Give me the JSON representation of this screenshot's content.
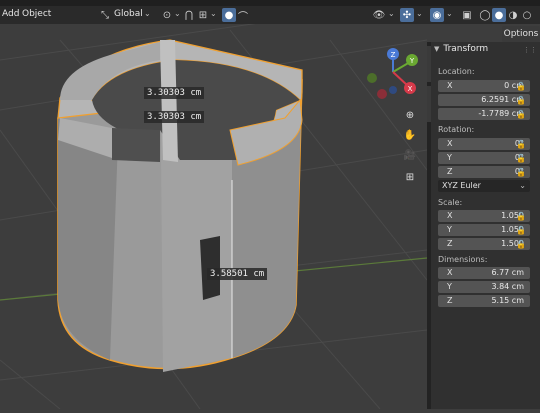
{
  "header": {
    "menus": [
      "Add",
      "Object"
    ],
    "orientation": "Global",
    "chevron": "⌄"
  },
  "viewport": {
    "measurements": [
      "3.30303 cm",
      "3.30303 cm",
      "3.58501 cm"
    ],
    "colors": {
      "background": "#3d3d3d",
      "object": "#a6a6a6",
      "outline": "#f0a030"
    }
  },
  "sidebar": {
    "options_label": "Options",
    "panel_title": "Transform",
    "location_label": "Location:",
    "location": [
      {
        "axis": "X",
        "value": "0 cm"
      },
      {
        "axis": "",
        "value": "6.2591 cm"
      },
      {
        "axis": "",
        "value": "-1.7789 cm"
      }
    ],
    "rotation_label": "Rotation:",
    "rotation": [
      {
        "axis": "X",
        "value": "0°"
      },
      {
        "axis": "Y",
        "value": "0°"
      },
      {
        "axis": "Z",
        "value": "0°"
      }
    ],
    "rotation_mode": "XYZ Euler",
    "scale_label": "Scale:",
    "scale": [
      {
        "axis": "X",
        "value": "1.050"
      },
      {
        "axis": "Y",
        "value": "1.050"
      },
      {
        "axis": "Z",
        "value": "1.500"
      }
    ],
    "dimensions_label": "Dimensions:",
    "dimensions": [
      {
        "axis": "X",
        "value": "6.77 cm"
      },
      {
        "axis": "Y",
        "value": "3.84 cm"
      },
      {
        "axis": "Z",
        "value": "5.15 cm"
      }
    ]
  },
  "gizmo": {
    "axes": [
      "Z",
      "Y",
      "X"
    ]
  }
}
